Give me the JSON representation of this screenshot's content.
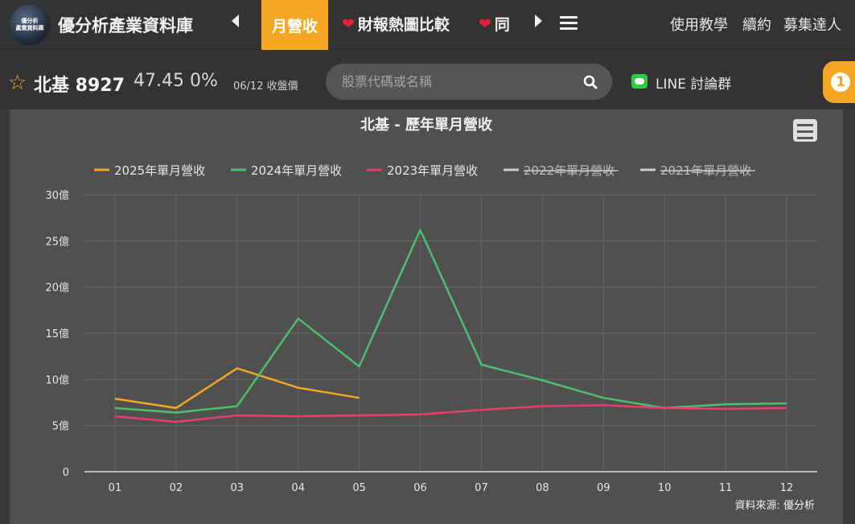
{
  "header": {
    "logo_line1": "優分析",
    "logo_line2": "產業資料庫",
    "site_title": "優分析產業資料庫",
    "tabs": [
      {
        "label": "月營收",
        "active": true
      },
      {
        "label": "財報熱圖比較",
        "icon": "heart-icon"
      },
      {
        "label": "同",
        "icon": "heart-icon"
      }
    ],
    "links": [
      "使用教學",
      "續約",
      "募集達人"
    ],
    "accent_color": "#f5a623"
  },
  "stock": {
    "name_code": "北基 8927",
    "price_change": "47.45 0%",
    "date_label": "06/12 收盤價"
  },
  "search": {
    "placeholder": "股票代碼或名稱"
  },
  "line_group": {
    "label": "LINE 討論群"
  },
  "notification": {
    "count": "1"
  },
  "chart_data": {
    "type": "line",
    "title": "北基 - 歷年單月營收",
    "categories": [
      "01",
      "02",
      "03",
      "04",
      "05",
      "06",
      "07",
      "08",
      "09",
      "10",
      "11",
      "12"
    ],
    "y_ticks": [
      "0",
      "5億",
      "10億",
      "15億",
      "20億",
      "25億",
      "30億"
    ],
    "ylim": [
      0,
      30
    ],
    "unit": "億",
    "grid": true,
    "legend_position": "top",
    "source_note": "資料來源: 優分析",
    "series": [
      {
        "name": "2025年單月營收",
        "color": "#f5a623",
        "visible": true,
        "values": [
          7.9,
          6.9,
          11.2,
          9.1,
          8.0,
          null,
          null,
          null,
          null,
          null,
          null,
          null
        ]
      },
      {
        "name": "2024年單月營收",
        "color": "#4cbf6e",
        "visible": true,
        "values": [
          6.9,
          6.4,
          7.1,
          16.6,
          11.4,
          26.2,
          11.6,
          9.9,
          8.0,
          6.9,
          7.3,
          7.4
        ]
      },
      {
        "name": "2023年單月營收",
        "color": "#e83e6c",
        "visible": true,
        "values": [
          6.0,
          5.4,
          6.1,
          6.0,
          6.1,
          6.2,
          6.7,
          7.1,
          7.2,
          6.9,
          6.8,
          6.9
        ]
      },
      {
        "name": "2022年單月營收",
        "color": "#cccccc",
        "visible": false,
        "values": []
      },
      {
        "name": "2021年單月營收",
        "color": "#cccccc",
        "visible": false,
        "values": []
      }
    ]
  }
}
